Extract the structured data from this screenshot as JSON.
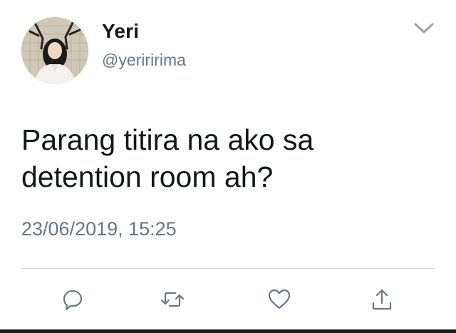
{
  "tweet": {
    "display_name": "Yeri",
    "handle": "@yeriririma",
    "text": "Parang titira na ako sa\ndetention room ah?",
    "timestamp": "23/06/2019, 15:25"
  },
  "icons": {
    "menu": "chevron-down-icon",
    "reply": "reply-icon",
    "retweet": "retweet-icon",
    "like": "heart-icon",
    "share": "share-icon"
  },
  "colors": {
    "text": "#14171a",
    "secondary": "#657786",
    "divider": "#d4d8dc"
  }
}
